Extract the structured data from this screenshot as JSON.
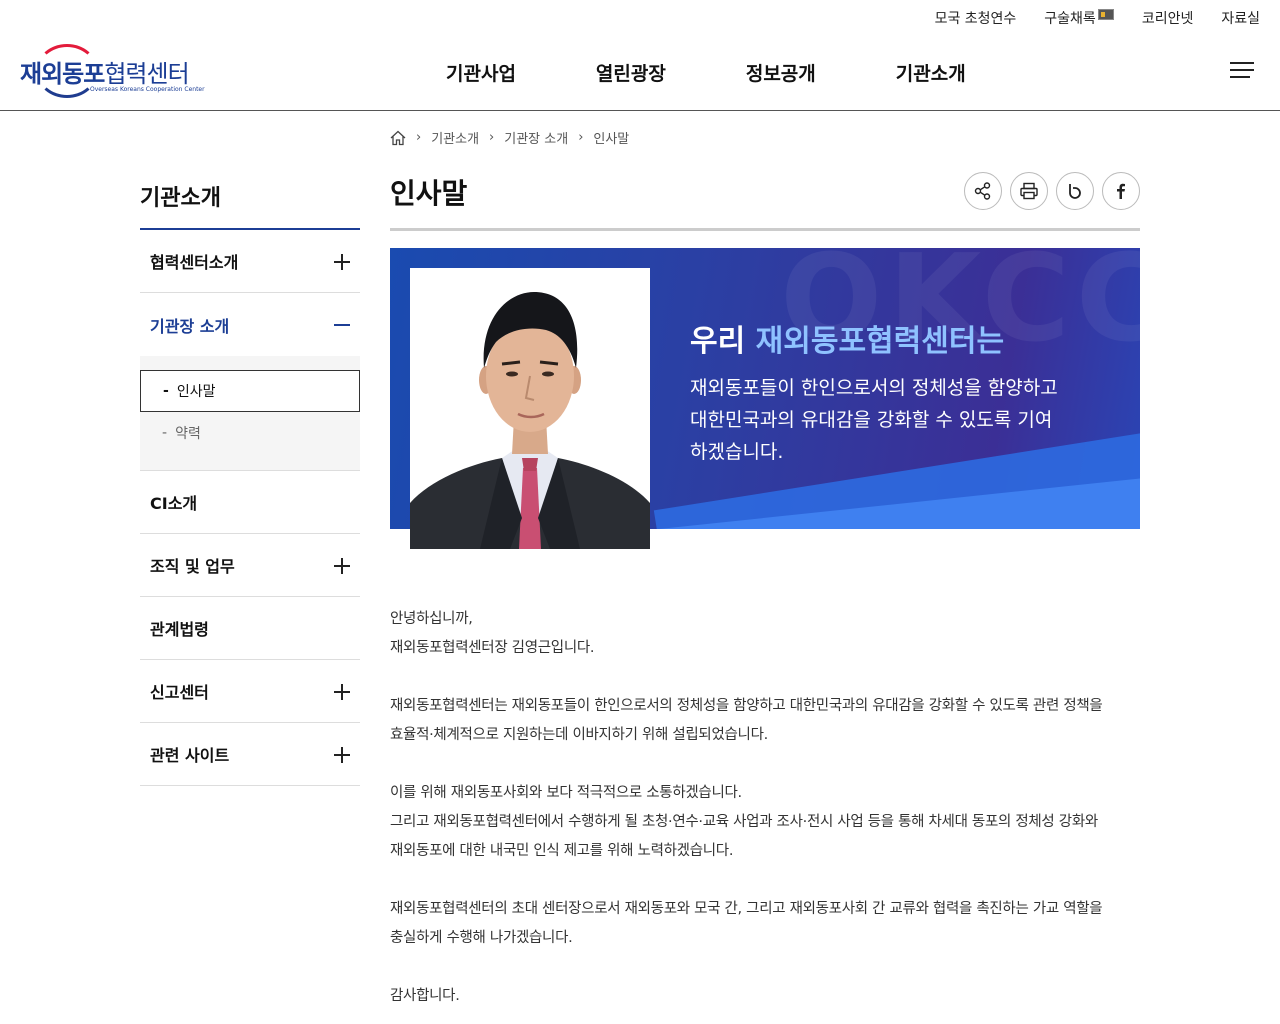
{
  "util_links": [
    "모국 초청연수",
    "구술채록",
    "코리안넷",
    "자료실"
  ],
  "logo": {
    "name": "재외동포협력센터",
    "name_a": "재외동포",
    "name_b": "협력센터",
    "sub": "Overseas Koreans Cooperation Center"
  },
  "gnb": [
    "기관사업",
    "열린광장",
    "정보공개",
    "기관소개"
  ],
  "sidebar": {
    "title": "기관소개",
    "items": [
      {
        "label": "협력센터소개"
      },
      {
        "label": "기관장 소개"
      },
      {
        "label": "CI소개"
      },
      {
        "label": "조직 및 업무"
      },
      {
        "label": "관계법령"
      },
      {
        "label": "신고센터"
      },
      {
        "label": "관련 사이트"
      }
    ],
    "sub_items": [
      {
        "label": "인사말"
      },
      {
        "label": "약력"
      }
    ]
  },
  "breadcrumb": [
    "기관소개",
    "기관장 소개",
    "인사말"
  ],
  "page_title": "인사말",
  "banner": {
    "heading_a": "우리 ",
    "heading_b": "재외동포협력센터는",
    "watermark": "OKCC",
    "text_1": "재외동포들이 한인으로서의 정체성을 함양하고",
    "text_2": "대한민국과의 유대감을 강화할 수 있도록 기여",
    "text_3": "하겠습니다."
  },
  "greeting": {
    "p1_1": "안녕하십니까,",
    "p1_2": "재외동포협력센터장 김영근입니다.",
    "p2_1": "재외동포협력센터는 재외동포들이 한인으로서의 정체성을 함양하고 대한민국과의 유대감을 강화할 수 있도록 관련 정책을",
    "p2_2": "효율적·체계적으로 지원하는데 이바지하기 위해 설립되었습니다.",
    "p3_1": "이를 위해 재외동포사회와 보다 적극적으로 소통하겠습니다.",
    "p3_2": "그리고 재외동포협력센터에서 수행하게 될 초청·연수·교육 사업과 조사·전시 사업 등을 통해 차세대 동포의 정체성 강화와",
    "p3_3": "재외동포에 대한 내국민 인식 제고를 위해 노력하겠습니다.",
    "p4_1": "재외동포협력센터의 초대 센터장으로서 재외동포와 모국 간, 그리고 재외동포사회 간 교류와 협력을 촉진하는 가교 역할을",
    "p4_2": "충실하게 수행해 나가겠습니다.",
    "p5_1": "감사합니다."
  },
  "colors": {
    "brand_blue": "#1c3e95",
    "brand_red": "#e31b3b",
    "banner_highlight": "#8fc2ff"
  }
}
